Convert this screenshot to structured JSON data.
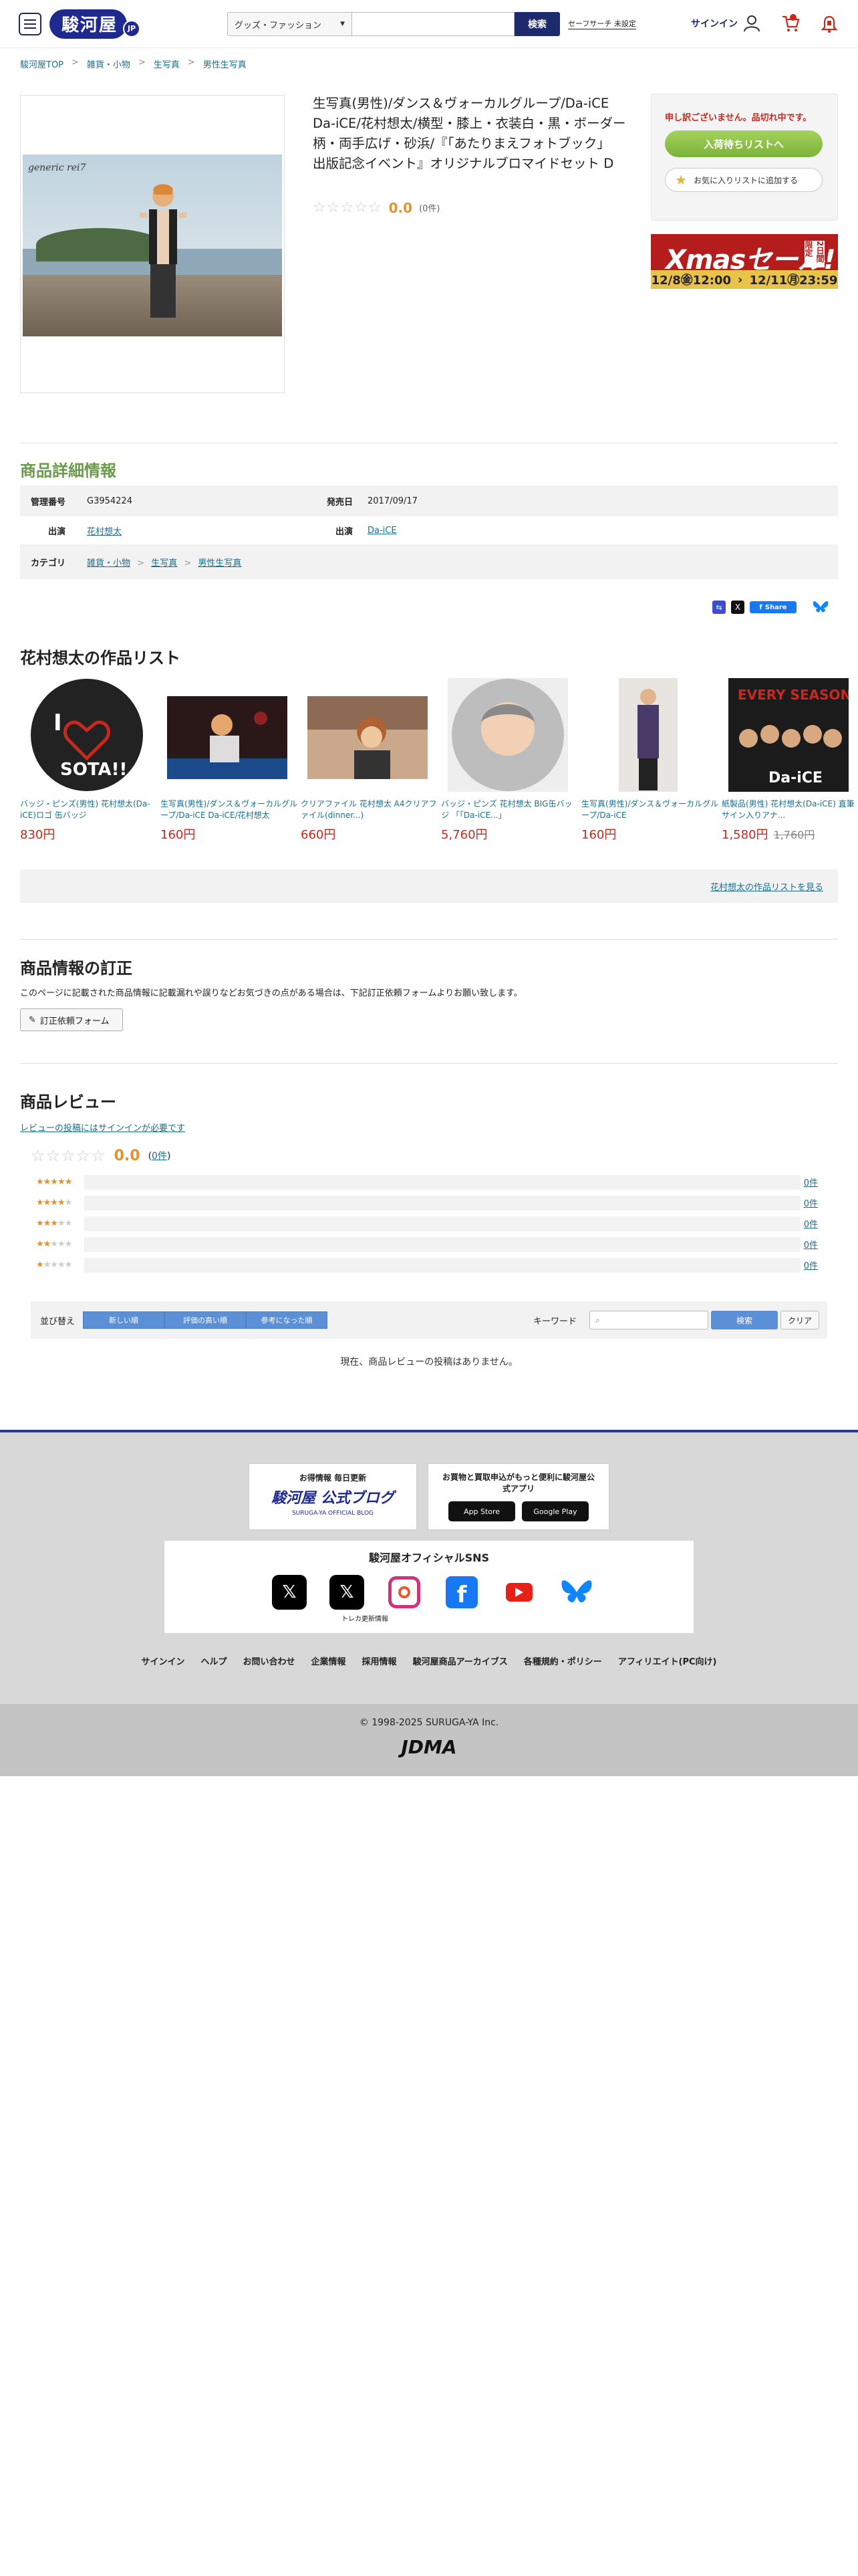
{
  "header": {
    "logo": "駿河屋",
    "logo_sub": "JP",
    "search_category": "グッズ・ファッション",
    "search_placeholder": "",
    "search_button": "検索",
    "safesearch": "セーフサーチ 未設定",
    "signin": "サインイン"
  },
  "breadcrumb": [
    "駿河屋TOP",
    "雑貨・小物",
    "生写真",
    "男性生写真"
  ],
  "product": {
    "image_caption": "generic rei7",
    "title": "生写真(男性)/ダンス＆ヴォーカルグループ/Da-iCE Da-iCE/花村想太/横型・膝上・衣装白・黒・ボーダー柄・両手広げ・砂浜/『「あたりまえフォトブック」 出版記念イベント』オリジナルブロマイドセット D",
    "stars": "☆☆☆☆☆",
    "rating": "0.0",
    "review_count": "(0件)",
    "soldout": "申し訳ございません。品切れ中です。",
    "wait_button": "入荷待ちリストへ",
    "fav_button": "お気に入りリストに追加する"
  },
  "xmas_banner": {
    "title": "Xmasセール!",
    "sub": "2日間限定",
    "start": "12/8㊎12:00",
    "end": "12/11㊊23:59"
  },
  "detail": {
    "heading": "商品詳細情報",
    "mgmt_label": "管理番号",
    "mgmt_value": "G3954224",
    "release_label": "発売日",
    "release_value": "2017/09/17",
    "cast_label": "出演",
    "cast_value": "花村想太",
    "cast2_label": "出演",
    "cast2_value": "Da-iCE",
    "category_label": "カテゴリ",
    "categories": [
      "雑貨・小物",
      "生写真",
      "男性生写真"
    ]
  },
  "share": {
    "fb_share": "Share"
  },
  "works": {
    "heading": "花村想太の作品リスト",
    "items": [
      {
        "name": "バッジ・ピンズ(男性) 花村想太(Da-iCE)ロゴ 缶バッジ",
        "price": "830円",
        "old": ""
      },
      {
        "name": "生写真(男性)/ダンス＆ヴォーカルグループ/Da-iCE Da-iCE/花村想太",
        "price": "160円",
        "old": ""
      },
      {
        "name": "クリアファイル 花村想太 A4クリアファイル(dinner...)",
        "price": "660円",
        "old": ""
      },
      {
        "name": "バッジ・ピンズ 花村想太 BIG缶バッジ 「「Da-iCE...」",
        "price": "5,760円",
        "old": ""
      },
      {
        "name": "生写真(男性)/ダンス＆ヴォーカルグループ/Da-iCE",
        "price": "160円",
        "old": ""
      },
      {
        "name": "紙製品(男性) 花村想太(Da-iCE) 直筆サイン入りアナ...",
        "price": "1,580円",
        "old": "1,760円"
      }
    ],
    "more": "花村想太の作品リストを見る"
  },
  "correction": {
    "heading": "商品情報の訂正",
    "desc": "このページに記載された商品情報に記載漏れや誤りなどお気づきの点がある場合は、下記訂正依頼フォームよりお願い致します。",
    "button": "訂正依頼フォーム"
  },
  "reviews": {
    "heading": "商品レビュー",
    "login_note": "レビューの投稿にはサインインが必要です",
    "stars": "☆☆☆☆☆",
    "rating": "0.0",
    "count": "0件",
    "bars": [
      {
        "count": "0件"
      },
      {
        "count": "0件"
      },
      {
        "count": "0件"
      },
      {
        "count": "0件"
      },
      {
        "count": "0件"
      }
    ],
    "sort_label": "並び替え",
    "sort_buttons": [
      "新しい順",
      "評価の高い順",
      "参考になった順"
    ],
    "keyword_label": "キーワード",
    "search": "検索",
    "clear": "クリア",
    "empty": "現在、商品レビューの投稿はありません。"
  },
  "footer": {
    "blog_top": "お得情報 毎日更新",
    "blog_title": "駿河屋 公式ブログ",
    "blog_sub": "SURUGA-YA OFFICIAL BLOG",
    "app_text": "お買物と買取申込がもっと便利に駿河屋公式アプリ",
    "app_store": "App Store",
    "google_play": "Google Play",
    "sns_title": "駿河屋オフィシャルSNS",
    "sns_caption": "トレカ更新情報",
    "links": [
      "サインイン",
      "ヘルプ",
      "お問い合わせ",
      "企業情報",
      "採用情報",
      "駿河屋商品アーカイブス",
      "各種規約・ポリシー",
      "アフィリエイト(PC向け)"
    ],
    "copyright": "© 1998-2025 SURUGA-YA Inc.",
    "jdma": "JDMA"
  }
}
